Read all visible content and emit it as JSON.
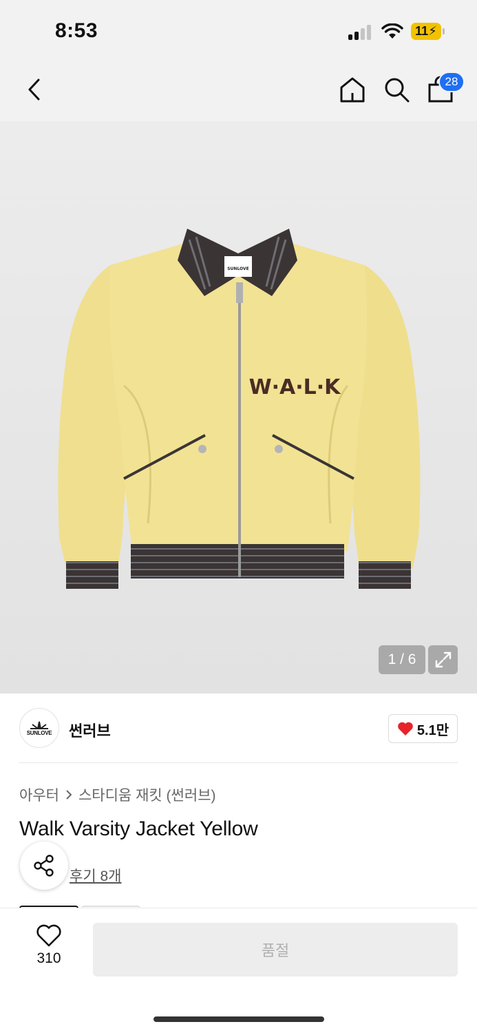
{
  "status_bar": {
    "time": "8:53",
    "battery_level": "11",
    "icons": [
      "signal-icon",
      "wifi-icon",
      "battery-icon"
    ]
  },
  "nav": {
    "cart_count": "28",
    "icons": [
      "back-icon",
      "home-icon",
      "search-icon",
      "cart-icon"
    ]
  },
  "gallery": {
    "page_indicator": "1 / 6",
    "logo_text": "SUNLOVE",
    "chest_text": "W·A·L·K",
    "icons": [
      "expand-icon"
    ]
  },
  "brand": {
    "logo_text": "SUNLOVE",
    "name": "썬러브",
    "likes": "5.1만",
    "icons": [
      "heart-icon"
    ]
  },
  "breadcrumb": {
    "category": "아우터",
    "subcategory": "스타디움 재킷 (썬러브)"
  },
  "product": {
    "title": "Walk Varsity Jacket Yellow",
    "reviews": "후기 8개",
    "icons": [
      "share-icon"
    ]
  },
  "bottom_bar": {
    "wish_count": "310",
    "cta_label": "품절",
    "icons": [
      "heart-outline-icon"
    ]
  },
  "colors": {
    "accent_blue": "#1f6ff2",
    "heart_red": "#e8232b",
    "jacket_yellow": "#f0df8e",
    "trim_brown": "#3b3434",
    "battery_yellow": "#f2c200"
  }
}
